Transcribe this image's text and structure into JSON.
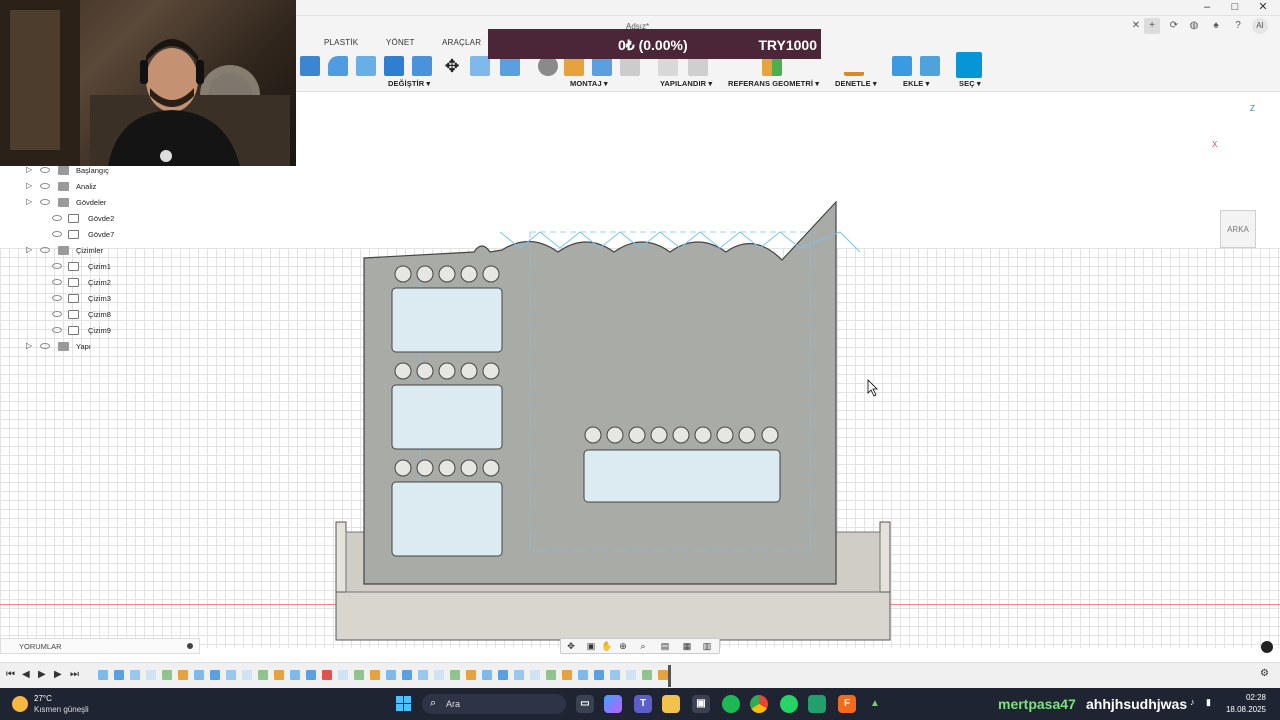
{
  "window": {
    "doc_title": "Adsız*",
    "controls": [
      "–",
      "□",
      "✕"
    ]
  },
  "ribbon": {
    "tabs": [
      "PLASTİK",
      "YÖNET",
      "ARAÇLAR"
    ],
    "groups": [
      "DEĞİŞTİR ▾",
      "MONTAJ ▾",
      "YAPILANDIR ▾",
      "REFERANS GEOMETRİ ▾",
      "DENETLE ▾",
      "EKLE ▾",
      "SEÇ ▾"
    ],
    "user_initials": "AI"
  },
  "donation": {
    "progress": "0₺ (0.00%)",
    "goal": "TRY1000"
  },
  "browser": {
    "items": [
      {
        "label": "Başlangıç",
        "sub": false
      },
      {
        "label": "Analiz",
        "sub": false
      },
      {
        "label": "Gövdeler",
        "sub": false
      },
      {
        "label": "Gövde2",
        "sub": true
      },
      {
        "label": "Gövde7",
        "sub": true
      },
      {
        "label": "Çizimler",
        "sub": false
      },
      {
        "label": "Çizim1",
        "sub": true
      },
      {
        "label": "Çizim2",
        "sub": true
      },
      {
        "label": "Çizim3",
        "sub": true
      },
      {
        "label": "Çizim8",
        "sub": true
      },
      {
        "label": "Çizim9",
        "sub": true
      },
      {
        "label": "Yapı",
        "sub": false
      }
    ]
  },
  "viewcube": {
    "face": "ARKA",
    "axis_z": "Z",
    "axis_x": "X"
  },
  "comments": {
    "label": "YORUMLAR"
  },
  "taskbar": {
    "weather_temp": "27°C",
    "weather_desc": "Kısmen güneşli",
    "search_placeholder": "Ara",
    "overlay_user1": "mertpasa47",
    "overlay_user2": "ahhjhsudhjwas",
    "time": "02:28",
    "date": "18.08.2025"
  },
  "colors": {
    "accent": "#0696d7",
    "donation_bg": "#4a2638",
    "taskbar_bg": "#1f2433"
  }
}
